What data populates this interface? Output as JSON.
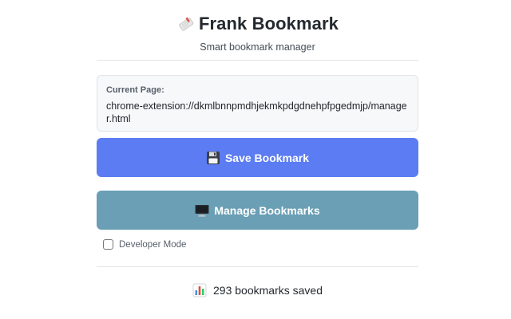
{
  "header": {
    "title": "Frank Bookmark",
    "subtitle": "Smart bookmark manager",
    "icon": "bookmark-tag-icon"
  },
  "current_page": {
    "label": "Current Page:",
    "url": "chrome-extension://dkmlbnnpmdhjekmkpdgdnehpfpgedmjp/manager.html"
  },
  "actions": {
    "save_label": "Save Bookmark",
    "save_icon": "floppy-disk-icon",
    "manage_label": "Manage Bookmarks",
    "manage_icon": "monitor-icon"
  },
  "developer_mode": {
    "label": "Developer Mode",
    "checked": false
  },
  "stats": {
    "text": "293 bookmarks saved",
    "icon": "bar-chart-icon"
  },
  "colors": {
    "save_button": "#5b7cf2",
    "manage_button": "#6a9fb5"
  }
}
